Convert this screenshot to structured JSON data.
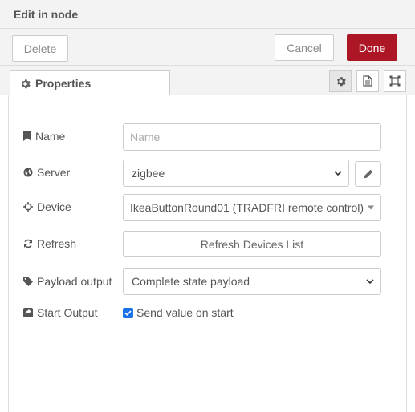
{
  "header": {
    "title": "Edit in node"
  },
  "toolbar": {
    "delete_label": "Delete",
    "cancel_label": "Cancel",
    "done_label": "Done"
  },
  "tabs": {
    "properties_label": "Properties"
  },
  "form": {
    "name": {
      "label": "Name",
      "placeholder": "Name",
      "value": ""
    },
    "server": {
      "label": "Server",
      "value": "zigbee"
    },
    "device": {
      "label": "Device",
      "value": "IkeaButtonRound01 (TRADFRI remote control)"
    },
    "refresh": {
      "label": "Refresh",
      "button_label": "Refresh Devices List"
    },
    "payload": {
      "label": "Payload output",
      "value": "Complete state payload"
    },
    "start_output": {
      "label": "Start Output",
      "checkbox_label": "Send value on start",
      "checked": true
    }
  },
  "colors": {
    "done": "#ad1625",
    "checkbox": "#1a73e8"
  },
  "icons": {
    "properties_tab": "gear-icon",
    "tab_buttons": [
      "gear-icon",
      "document-icon",
      "frame-icon"
    ],
    "name": "bookmark-icon",
    "server": "globe-icon",
    "device": "crosshairs-icon",
    "refresh": "refresh-icon",
    "payload": "tag-icon",
    "start_output": "share-square-icon",
    "server_edit": "pencil-icon"
  }
}
